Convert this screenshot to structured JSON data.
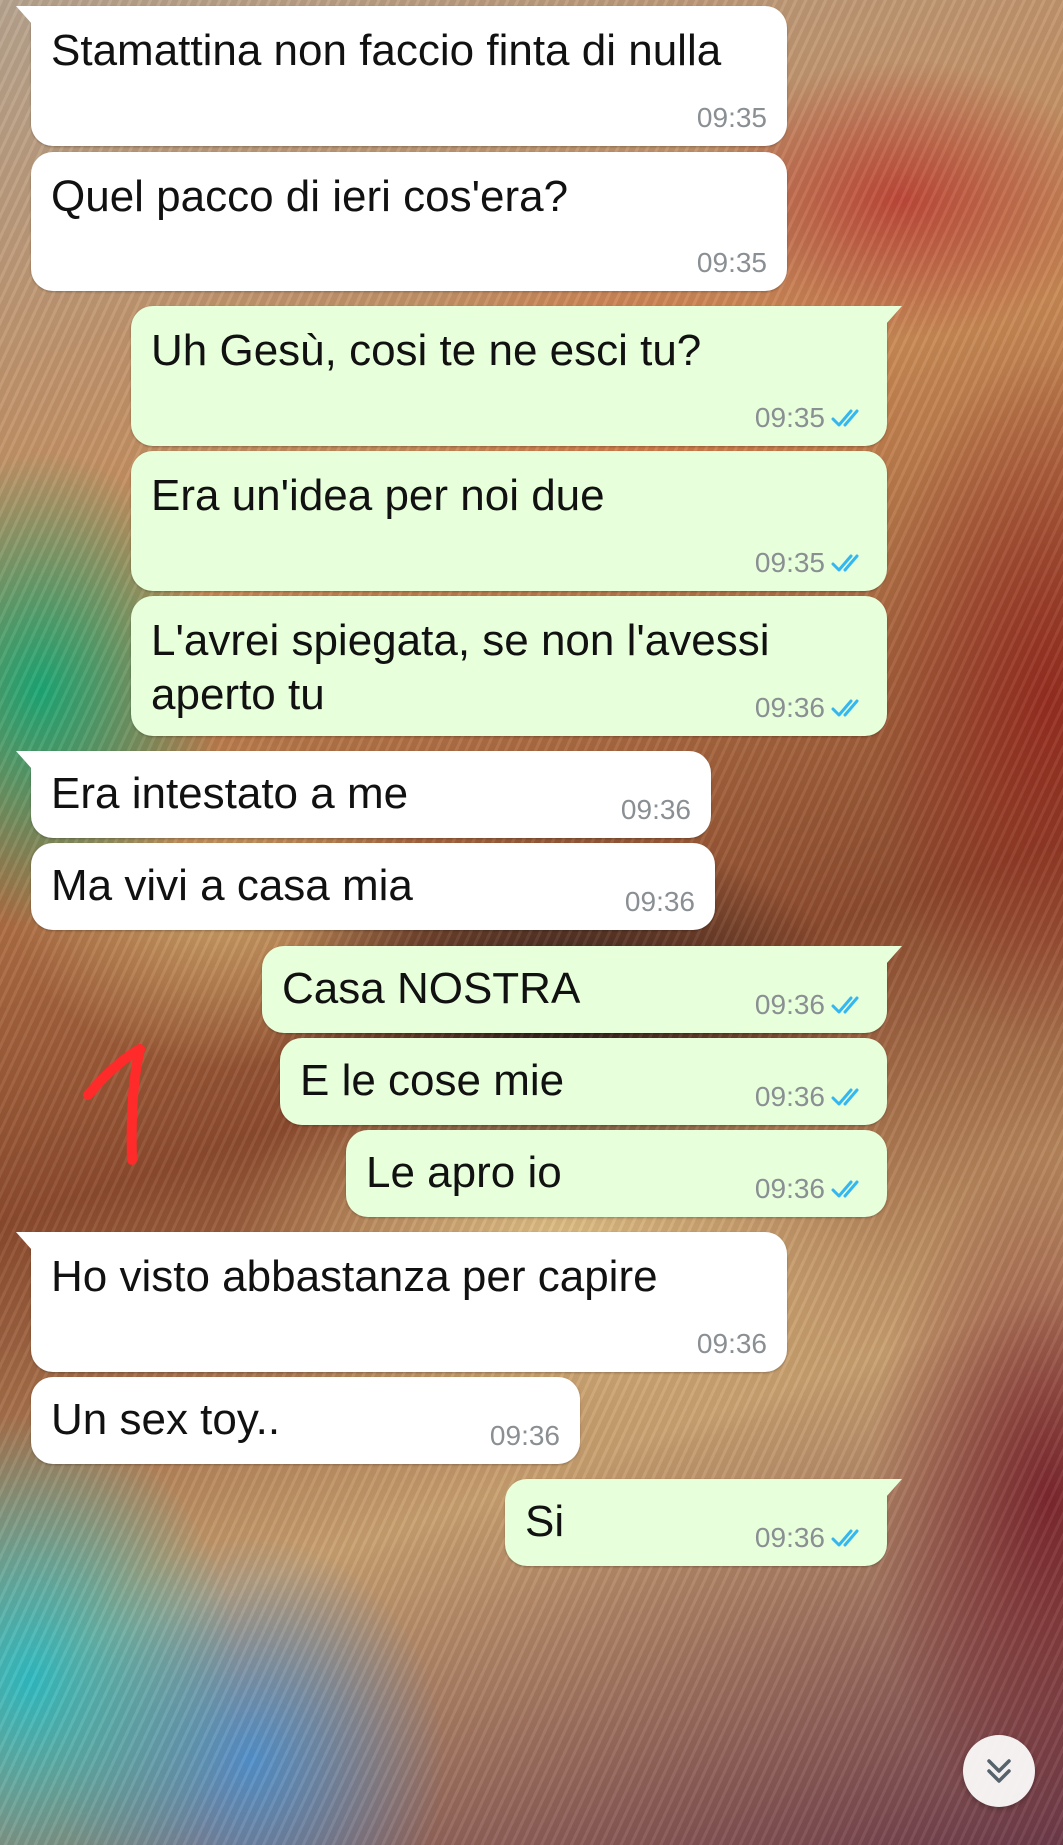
{
  "messages": [
    {
      "direction": "in",
      "text": "Stamattina non faccio finta di nulla",
      "time": "09:35"
    },
    {
      "direction": "in",
      "text": "Quel pacco di ieri cos'era?",
      "time": "09:35"
    },
    {
      "direction": "out",
      "text": "Uh Gesù, cosi te ne esci tu?",
      "time": "09:35",
      "status": "read"
    },
    {
      "direction": "out",
      "text": "Era un'idea per noi due",
      "time": "09:35",
      "status": "read"
    },
    {
      "direction": "out",
      "text": "L'avrei spiegata, se non l'avessi aperto tu",
      "time": "09:36",
      "status": "read"
    },
    {
      "direction": "in",
      "text": "Era intestato a me",
      "time": "09:36"
    },
    {
      "direction": "in",
      "text": "Ma vivi a casa mia",
      "time": "09:36"
    },
    {
      "direction": "out",
      "text": "Casa NOSTRA",
      "time": "09:36",
      "status": "read"
    },
    {
      "direction": "out",
      "text": "E le cose mie",
      "time": "09:36",
      "status": "read"
    },
    {
      "direction": "out",
      "text": "Le apro io",
      "time": "09:36",
      "status": "read"
    },
    {
      "direction": "in",
      "text": "Ho visto abbastanza per capire",
      "time": "09:36"
    },
    {
      "direction": "in",
      "text": "Un sex toy..",
      "time": "09:36"
    },
    {
      "direction": "out",
      "text": "Si",
      "time": "09:36",
      "status": "read"
    }
  ],
  "colors": {
    "incoming_bubble": "#ffffff",
    "outgoing_bubble": "#e7ffdb",
    "read_ticks": "#34b7f1",
    "timestamp": "#8a8f93",
    "annotation_mark": "#ff2a2a"
  },
  "icons": {
    "read_receipt": "double-check-icon",
    "scroll_down": "double-chevron-down-icon"
  },
  "annotation": {
    "text": "1"
  }
}
